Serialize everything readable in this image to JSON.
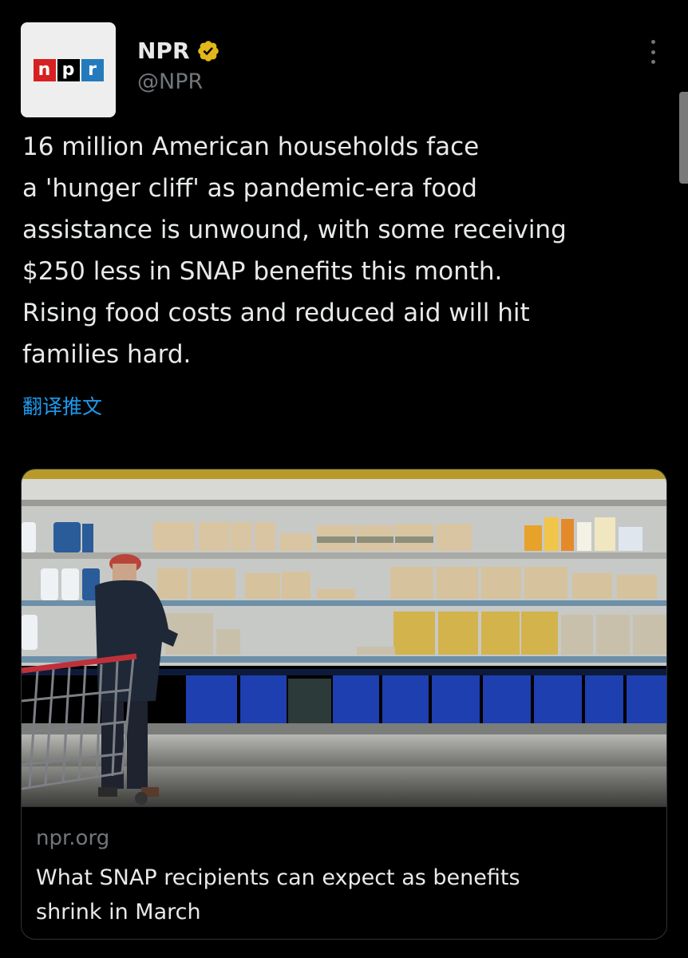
{
  "author": {
    "display_name": "NPR",
    "handle": "@NPR",
    "verified": true,
    "avatar_logo_letters": [
      "n",
      "p",
      "r"
    ]
  },
  "tweet": {
    "text_lines": [
      "16 million American households face",
      "a 'hunger cliff' as pandemic-era food",
      "assistance is unwound, with some receiving",
      "$250 less in SNAP benefits this month.",
      "Rising food costs and reduced aid will hit",
      "families hard."
    ],
    "translate_label": "翻译推文"
  },
  "card": {
    "domain": "npr.org",
    "title_lines": [
      "What SNAP recipients can expect as benefits",
      "shrink in March"
    ],
    "image_icon": "grocery-egg-shelf-photo"
  },
  "icons": {
    "more": "more-options-icon",
    "verified": "verified-badge-icon"
  },
  "colors": {
    "background": "#000000",
    "text_primary": "#e7e9ea",
    "text_secondary": "#71767b",
    "link": "#1d9bf0",
    "verified_gold": "#e2b719",
    "card_border": "#2f3336"
  }
}
